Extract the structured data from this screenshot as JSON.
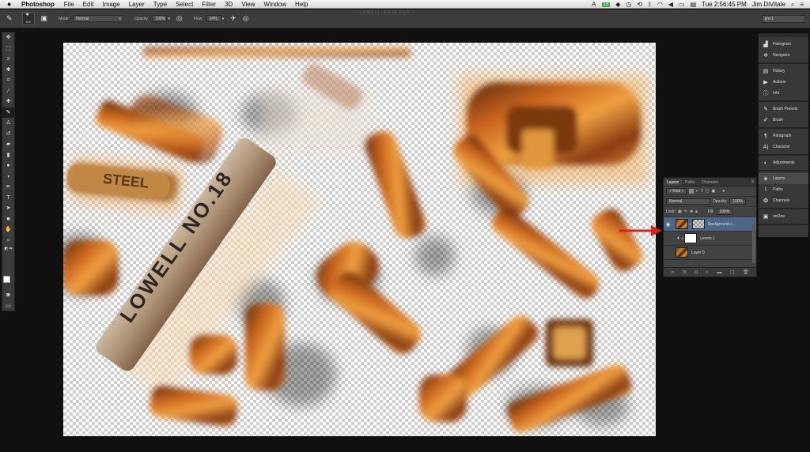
{
  "menubar": {
    "apple": "",
    "app_name": "Photoshop",
    "items": [
      "File",
      "Edit",
      "Image",
      "Layer",
      "Type",
      "Select",
      "Filter",
      "3D",
      "View",
      "Window",
      "Help"
    ],
    "status_badge": "15",
    "clock": "Tue 2:56:45 PM",
    "user": "Jim DiVitale"
  },
  "options": {
    "brush_size": "100",
    "mode_label": "Mode:",
    "mode_value": "Normal",
    "opacity_label": "Opacity:",
    "opacity_value": "100%",
    "flow_label": "Flow:",
    "flow_value": "24%",
    "document_title": "LOWELL_NO18.PSD",
    "workspace": "jim-1"
  },
  "tools": [
    "move-tool",
    "marquee-tool",
    "lasso-tool",
    "quick-selection-tool",
    "crop-tool",
    "eyedropper-tool",
    "healing-brush-tool",
    "brush-tool",
    "clone-stamp-tool",
    "history-brush-tool",
    "eraser-tool",
    "gradient-tool",
    "blur-tool",
    "dodge-tool",
    "pen-tool",
    "type-tool",
    "path-selection-tool",
    "rectangle-tool",
    "hand-tool",
    "zoom-tool"
  ],
  "layers_panel": {
    "tabs": [
      "Layers",
      "Paths",
      "Channels"
    ],
    "active_tab": "Layers",
    "filter_label": "Kind",
    "blend_mode": "Normal",
    "opacity_label": "Opacity:",
    "opacity_value": "100%",
    "lock_label": "Lock:",
    "fill_label": "Fill:",
    "fill_value": "100%",
    "layers": [
      {
        "name": "Background c...",
        "visible": true,
        "selected": true
      },
      {
        "name": "Levels 1",
        "visible": false,
        "selected": false
      },
      {
        "name": "Layer 0",
        "visible": false,
        "selected": false
      }
    ]
  },
  "dock": {
    "groups": [
      [
        "Histogram",
        "Navigator"
      ],
      [
        "History",
        "Actions",
        "Info"
      ],
      [
        "Brush Presets",
        "Brush"
      ],
      [
        "Paragraph",
        "Character"
      ],
      [
        "Adjustments"
      ],
      [
        "Layers",
        "Paths",
        "Channels"
      ],
      [
        "onOne"
      ]
    ],
    "active": "Layers"
  },
  "canvas_text": {
    "steel_stamp": "STEEL",
    "lowell_stamp": "LOWELL NO.18"
  },
  "colors": {
    "rust_dark": "#5a2a10",
    "rust_mid": "#c8641e",
    "rust_light": "#f0a040",
    "selection_blue": "#4d6687",
    "arrow_red": "#d8221c"
  }
}
